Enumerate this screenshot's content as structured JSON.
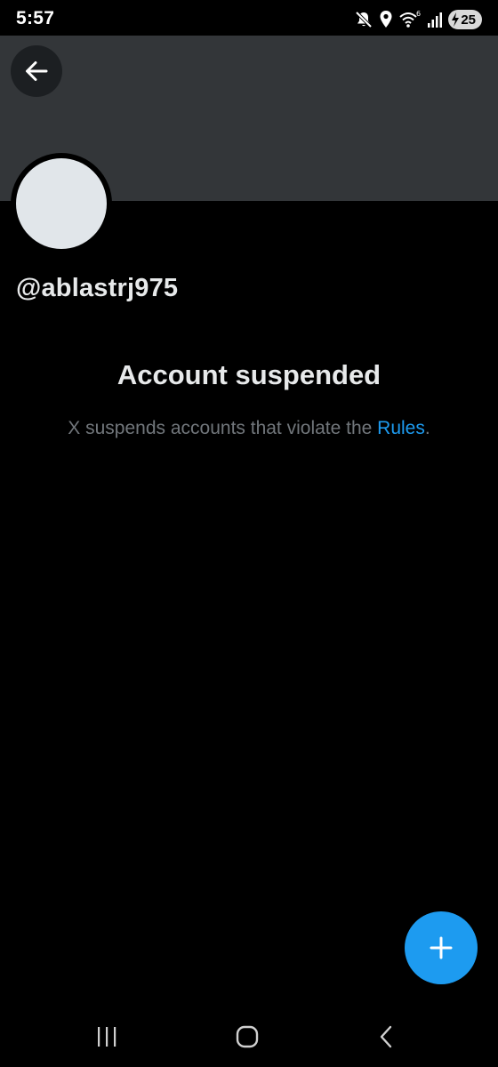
{
  "status_bar": {
    "time": "5:57",
    "battery": "25",
    "icons": [
      "mute-icon",
      "location-icon",
      "wifi-icon",
      "signal-icon",
      "battery-icon"
    ]
  },
  "profile": {
    "handle": "@ablastrj975"
  },
  "suspension": {
    "title": "Account suspended",
    "description_prefix": "X suspends accounts that violate the ",
    "rules_link": "Rules",
    "description_suffix": "."
  },
  "colors": {
    "background": "#000000",
    "banner": "#333639",
    "accent": "#1d9bf0",
    "secondary_text": "#71767b",
    "avatar": "#e1e6ea"
  },
  "nav_bar": {
    "icons": [
      "recent-apps-icon",
      "home-icon",
      "back-icon"
    ]
  },
  "fab": {
    "icon": "plus-icon"
  }
}
